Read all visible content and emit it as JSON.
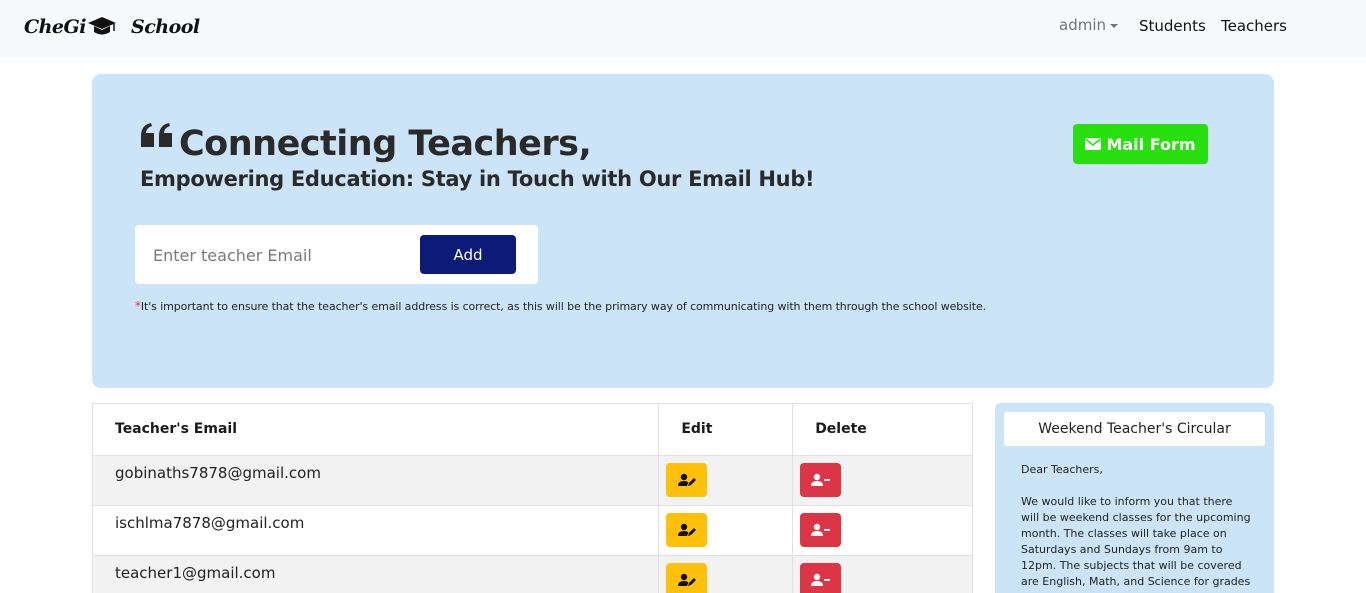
{
  "brand": {
    "name_part1": "CheGi",
    "name_part2": "School",
    "logo_icon": "graduation-cap-icon"
  },
  "nav": {
    "admin_label": "admin",
    "students_label": "Students",
    "teachers_label": "Teachers"
  },
  "hero": {
    "title": "Connecting Teachers,",
    "subtitle": "Empowering Education: Stay in Touch with Our Email Hub!",
    "mail_button_label": "Mail Form",
    "email_placeholder": "Enter teacher Email",
    "add_button_label": "Add",
    "note_star": "*",
    "note_text": "It's important to ensure that the teacher's email address is correct, as this will be the primary way of communicating with them through the school website.",
    "colors": {
      "background": "#cce4f8",
      "mail_button": "#28e010",
      "add_button": "#0d1a78"
    }
  },
  "table": {
    "headers": {
      "email": "Teacher's Email",
      "edit": "Edit",
      "delete": "Delete"
    },
    "rows": [
      {
        "email": "gobinaths7878@gmail.com"
      },
      {
        "email": "ischlma7878@gmail.com"
      },
      {
        "email": "teacher1@gmail.com"
      }
    ],
    "colors": {
      "edit": "#ffc107",
      "delete": "#dc3545"
    }
  },
  "circular": {
    "title": "Weekend Teacher's Circular",
    "greeting": "Dear Teachers,",
    "body": "We would like to inform you that there will be weekend classes for the upcoming month. The classes will take place on Saturdays and Sundays from 9am to 12pm. The subjects that will be covered are English, Math, and Science for grades"
  }
}
